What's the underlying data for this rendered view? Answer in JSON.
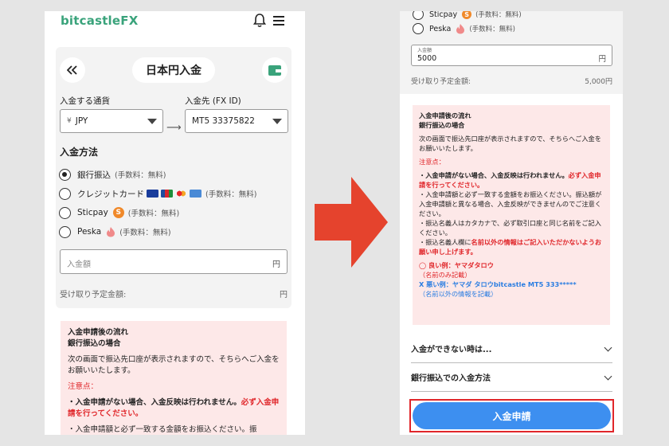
{
  "left": {
    "logo": "bitcastleFX",
    "title": "日本円入金",
    "currency_label": "入金する通貨",
    "currency_value": "JPY",
    "dest_label": "入金先 (FX ID)",
    "dest_value": "MT5 33375822",
    "method_heading": "入金方法",
    "methods": [
      {
        "label": "銀行振込",
        "fee": "(手数料：無料)"
      },
      {
        "label": "クレジットカード",
        "fee": "(手数料：無料)"
      },
      {
        "label": "Sticpay",
        "fee": "(手数料：無料)"
      },
      {
        "label": "Peska",
        "fee": "(手数料：無料)"
      }
    ],
    "amount_placeholder": "入金額",
    "amount_unit": "円",
    "estimate_label": "受け取り予定金額:",
    "estimate_unit": "円",
    "notice": {
      "heading1": "入金申請後の流れ",
      "heading2": "銀行振込の場合",
      "intro": "次の画面で振込先口座が表示されますので、そちらへご入金をお願いいたします。",
      "caution": "注意点：",
      "point1_a": "・入金申請がない場合、入金反映は行われません。",
      "point1_b": "必ず入金申請を行ってください。",
      "point2": "・入金申請額と必ず一致する金額をお振込ください。振"
    }
  },
  "right": {
    "methods": [
      {
        "label": "Sticpay",
        "fee": "(手数料：無料)"
      },
      {
        "label": "Peska",
        "fee": "(手数料：無料)"
      }
    ],
    "amount_tiny_label": "入金額",
    "amount_value": "5000",
    "amount_unit": "円",
    "estimate_label": "受け取り予定金額:",
    "estimate_value": "5,000円",
    "notice": {
      "heading1": "入金申請後の流れ",
      "heading2": "銀行振込の場合",
      "intro": "次の画面で振込先口座が表示されますので、そちらへご入金をお願いいたします。",
      "caution": "注意点：",
      "point1_a": "・入金申請がない場合、入金反映は行われません。",
      "point1_b": "必ず入金申請を行ってください。",
      "point2": "・入金申請額と必ず一致する金額をお振込ください。振込額が入金申請額と異なる場合、入金反映ができませんのでご注意ください。",
      "point3": "・振込名義人はカタカナで、必ず取引口座と同じ名前をご記入ください。",
      "point4_a": "・振込名義人欄に",
      "point4_b": "名前以外の情報はご記入いただかないようお願い申し上げます。",
      "good": "◯ 良い例：ヤマダタロウ",
      "good_sub": "（名前のみ記載）",
      "bad": "X 悪い例：ヤマダ タロウbitcastle MT5 333*****",
      "bad_sub": "（名前以外の情報を記載）"
    },
    "accordion1": "入金ができない時は...",
    "accordion2": "銀行振込での入金方法",
    "submit_label": "入金申請"
  },
  "colors": {
    "brand": "#3aa37b",
    "submit": "#3d8ff0",
    "highlight": "#e0262a",
    "arrow": "#e5432d",
    "notice_bg": "#fde8e8"
  }
}
